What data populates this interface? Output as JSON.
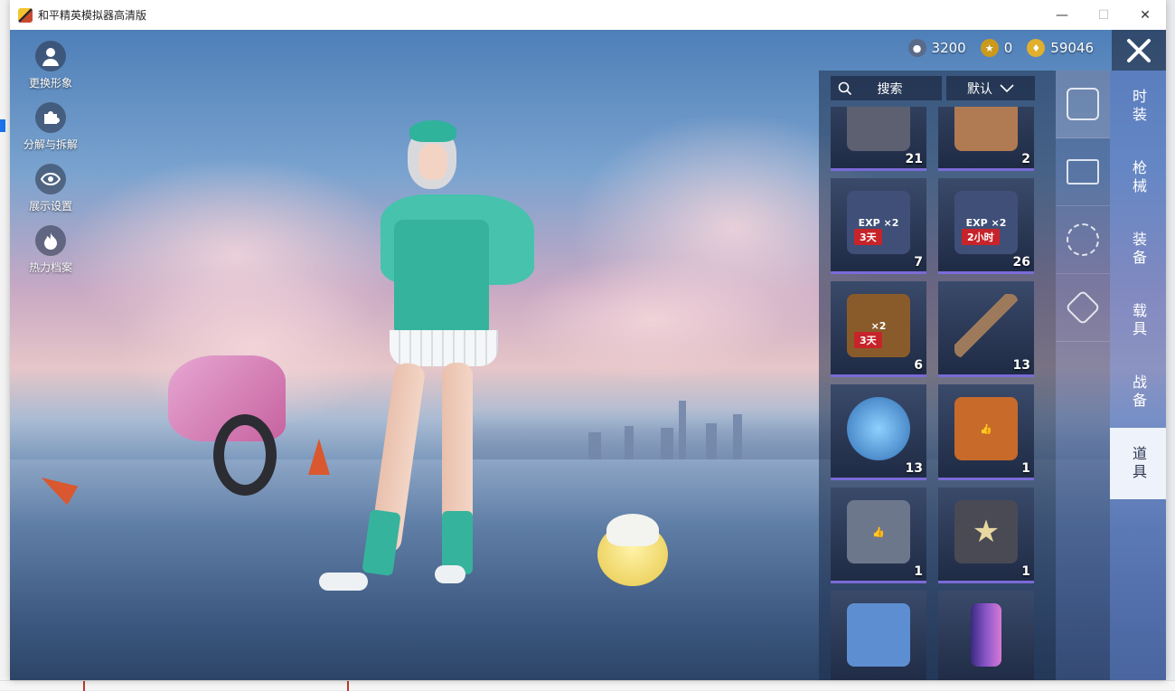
{
  "window": {
    "title": "和平精英模拟器高清版",
    "controls": [
      "minimize",
      "maximize",
      "close"
    ]
  },
  "left_menu": [
    {
      "label": "更换形象",
      "icon": "avatar-icon"
    },
    {
      "label": "分解与拆解",
      "icon": "puzzle-icon"
    },
    {
      "label": "展示设置",
      "icon": "eye-icon"
    },
    {
      "label": "热力档案",
      "icon": "flame-icon"
    }
  ],
  "currency": [
    {
      "icon": "silver-coin-icon",
      "value": "3200",
      "color": "#5a6b8a"
    },
    {
      "icon": "bonus-coin-icon",
      "value": "0",
      "color": "#c99a1c"
    },
    {
      "icon": "gold-coin-icon",
      "value": "59046",
      "color": "#e0b02c"
    }
  ],
  "inventory": {
    "search_label": "搜索",
    "sort_label": "默认",
    "items": [
      {
        "name": "spring-parts",
        "qty": "21",
        "tag": "",
        "color": "#5d6070"
      },
      {
        "name": "supply-crate",
        "qty": "2",
        "tag": "",
        "color": "#b07a52"
      },
      {
        "name": "exp-card-x2",
        "qty": "7",
        "tag": "3天",
        "color": "#3f4f78"
      },
      {
        "name": "exp-card-x2",
        "qty": "26",
        "tag": "2小时",
        "color": "#3f4f78"
      },
      {
        "name": "coin-card-x2",
        "qty": "6",
        "tag": "3天",
        "color": "#8a5b2a"
      },
      {
        "name": "wooden-rod",
        "qty": "13",
        "tag": "",
        "color": "#9c7a5b"
      },
      {
        "name": "puzzle-orb",
        "qty": "13",
        "tag": "",
        "color": "#3d87c9"
      },
      {
        "name": "gold-medal",
        "qty": "1",
        "tag": "",
        "color": "#c76a2a"
      },
      {
        "name": "silver-medal",
        "qty": "1",
        "tag": "",
        "color": "#6d778c"
      },
      {
        "name": "star-badge",
        "qty": "1",
        "tag": "",
        "color": "#4a4a55"
      },
      {
        "name": "planet-card",
        "qty": "",
        "tag": "",
        "color": "#5d8ed1"
      },
      {
        "name": "spray-can",
        "qty": "",
        "tag": "",
        "color": "#8a56c9"
      }
    ]
  },
  "categories": [
    {
      "icon": "card-icon",
      "active": true
    },
    {
      "icon": "chest-icon",
      "active": false
    },
    {
      "icon": "firework-icon",
      "active": false
    },
    {
      "icon": "ticket-icon",
      "active": false
    }
  ],
  "tabs": [
    {
      "label": "时装",
      "active": false
    },
    {
      "label": "枪械",
      "active": false
    },
    {
      "label": "装备",
      "active": false
    },
    {
      "label": "载具",
      "active": false
    },
    {
      "label": "战备",
      "active": false
    },
    {
      "label": "道具",
      "active": true
    }
  ]
}
